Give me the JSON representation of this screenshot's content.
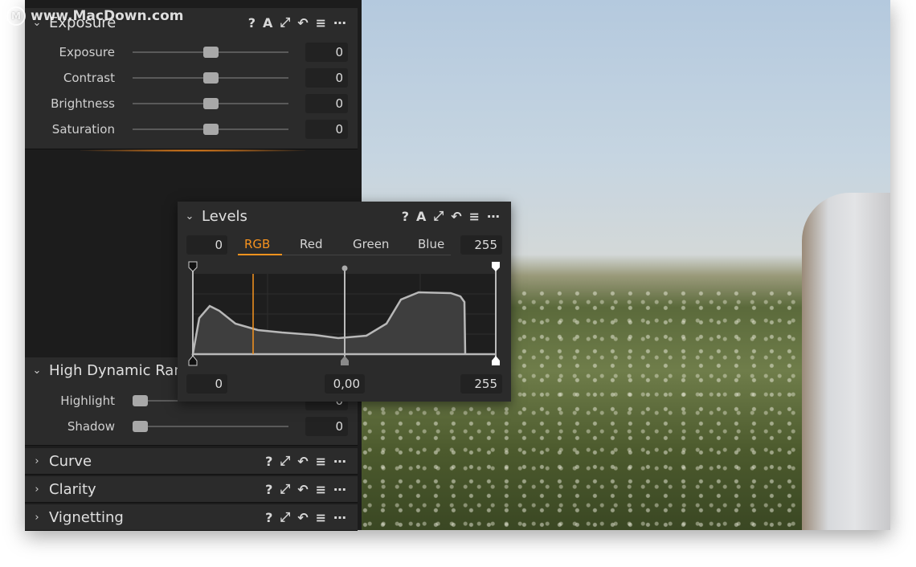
{
  "watermark": "www.MacDown.com",
  "exposure": {
    "title": "Exposure",
    "tools": [
      "?",
      "A",
      "⤢",
      "↶",
      "≡",
      "⋯"
    ],
    "rows": [
      {
        "label": "Exposure",
        "value": "0"
      },
      {
        "label": "Contrast",
        "value": "0"
      },
      {
        "label": "Brightness",
        "value": "0"
      },
      {
        "label": "Saturation",
        "value": "0"
      }
    ],
    "slider_position": 0.5
  },
  "hdr": {
    "title": "High Dynamic Ran",
    "rows": [
      {
        "label": "Highlight",
        "value": "0"
      },
      {
        "label": "Shadow",
        "value": "0"
      }
    ],
    "slider_position": 0
  },
  "collapsed": [
    {
      "title": "Curve"
    },
    {
      "title": "Clarity"
    },
    {
      "title": "Vignetting"
    }
  ],
  "collapsed_tools": [
    "?",
    "⤢",
    "↶",
    "≡",
    "⋯"
  ],
  "levels": {
    "title": "Levels",
    "tools": [
      "?",
      "A",
      "⤢",
      "↶",
      "≡",
      "⋯"
    ],
    "input_low": "0",
    "input_high": "255",
    "tabs": [
      "RGB",
      "Red",
      "Green",
      "Blue"
    ],
    "active_tab": "RGB",
    "output_low": "0",
    "midtone": "0,00",
    "output_high": "255"
  },
  "colors": {
    "accent": "#f7931e",
    "panel": "#2b2b2b",
    "background": "#1c1c1c"
  }
}
